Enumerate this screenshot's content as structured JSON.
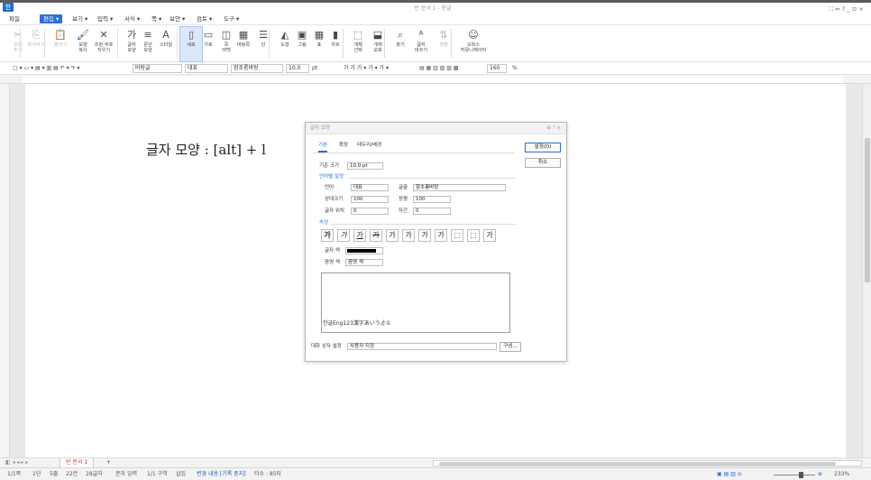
{
  "app": {
    "title": "빈 문서 1 - 한글",
    "icon": "hwp-app-icon"
  },
  "menubar": {
    "file": "파일",
    "items": [
      "편집 ▾",
      "보기 ▾",
      "입력 ▾",
      "서식 ▾",
      "쪽 ▾",
      "보안 ▾",
      "검토 ▾",
      "도구 ▾"
    ],
    "window_controls": "⛶ ⇔ ? _ ㅁ ×"
  },
  "ribbon": {
    "buttons": [
      {
        "label": "오려\n두기",
        "icon": "scissors-icon",
        "glyph": "✂",
        "disabled": true
      },
      {
        "label": "복사하기",
        "icon": "copy-icon",
        "glyph": "⎘",
        "disabled": true
      },
      {
        "label": "붙이기",
        "icon": "paste-icon",
        "glyph": "📋",
        "disabled": true
      },
      {
        "label": "모양\n복사",
        "icon": "format-painter-icon",
        "glyph": "🖌",
        "disabled": false
      },
      {
        "label": "조판 부호\n지우기",
        "icon": "clear-format-icon",
        "glyph": "✕",
        "disabled": false
      },
      {
        "label": "글자\n모양",
        "icon": "char-shape-icon",
        "glyph": "가",
        "disabled": false
      },
      {
        "label": "문단\n모양",
        "icon": "para-shape-icon",
        "glyph": "≡",
        "disabled": false
      },
      {
        "label": "스타일",
        "icon": "style-icon",
        "glyph": "A",
        "disabled": false
      },
      {
        "label": "세로",
        "icon": "portrait-icon",
        "glyph": "▯",
        "disabled": false,
        "selected": true
      },
      {
        "label": "가로",
        "icon": "landscape-icon",
        "glyph": "▭",
        "disabled": false
      },
      {
        "label": "쪽\n여백",
        "icon": "page-margin-icon",
        "glyph": "◫",
        "disabled": false
      },
      {
        "label": "바탕쪽",
        "icon": "master-page-icon",
        "glyph": "▦",
        "disabled": false
      },
      {
        "label": "단",
        "icon": "columns-icon",
        "glyph": "☰",
        "disabled": false
      },
      {
        "label": "도형",
        "icon": "shape-icon",
        "glyph": "◭",
        "disabled": false
      },
      {
        "label": "그림",
        "icon": "picture-icon",
        "glyph": "▣",
        "disabled": false
      },
      {
        "label": "표",
        "icon": "table-icon",
        "glyph": "▦",
        "disabled": false
      },
      {
        "label": "차트",
        "icon": "chart-icon",
        "glyph": "▮",
        "disabled": false
      },
      {
        "label": "개체\n선택",
        "icon": "object-select-icon",
        "glyph": "⬚",
        "disabled": false
      },
      {
        "label": "개체\n보호",
        "icon": "object-protect-icon",
        "glyph": "⬓",
        "disabled": false
      },
      {
        "label": "찾기",
        "icon": "find-icon",
        "glyph": "⌕",
        "disabled": false
      },
      {
        "label": "글자\n바꾸기",
        "icon": "replace-icon",
        "glyph": "ᴬ",
        "disabled": false
      },
      {
        "label": "정렬",
        "icon": "sort-icon",
        "glyph": "⇅",
        "disabled": true
      },
      {
        "label": "오피스\n커뮤니케이터",
        "icon": "office-communicator-icon",
        "glyph": "☺",
        "disabled": false
      }
    ]
  },
  "toolbar": {
    "style_box": "바탕글",
    "lang_box": "대표",
    "font_box": "함초롬바탕",
    "size_box": "10.0",
    "size_unit": "pt",
    "bold_italic_underline": "가 가 가 ▾ 가 ▾ 가 ▾",
    "zoom_box": "160",
    "zoom_unit": "%"
  },
  "document": {
    "text": "글자 모양 : [alt] + l"
  },
  "dialog": {
    "title": "글자 모양",
    "title_controls": "⊞ ? ×",
    "tabs": [
      "기본",
      "확장",
      "테두리/배경"
    ],
    "ok": "설정(D)",
    "cancel": "취소",
    "base_size_label": "기준 크기",
    "base_size_value": "10.0",
    "base_size_unit": "pt",
    "lang_section": "언어별 설정",
    "lang_label": "언어",
    "lang_value": "대표",
    "font_label": "글꼴",
    "font_value": "함초롬바탕",
    "ratio_label": "상대크기",
    "ratio_value": "100",
    "width_label": "장평",
    "width_value": "100",
    "pos_label": "글자 위치",
    "pos_value": "0",
    "spacing_label": "자간",
    "spacing_value": "0",
    "percent": "%",
    "attr_section": "속성",
    "attr_glyphs": [
      "가",
      "가",
      "가",
      "가",
      "가",
      "가",
      "가",
      "가",
      "⬚",
      "⬚",
      "가"
    ],
    "attr_icons": [
      "bold-icon",
      "italic-icon",
      "underline-icon",
      "strikethrough-icon",
      "outline-icon",
      "shadow-icon",
      "emboss-icon",
      "engrave-icon",
      "superscript-icon",
      "subscript-icon",
      "normal-icon"
    ],
    "text_color_label": "글자 색",
    "shade_color_label": "음영 색",
    "shade_color_value": "음영 색",
    "preview_text": "한글Eng123漢字あいうゟ①",
    "preset_label": "대화 상자 설정",
    "preset_value": "사용자 지정",
    "config_button": "구성..."
  },
  "tabbar": {
    "sheet": "빈 문서 1",
    "add": "+"
  },
  "status": {
    "items": [
      "1/1쪽",
      "1단",
      "5줄",
      "22칸",
      "28글자",
      "문자 입력",
      "1/1 구역",
      "삽입",
      "변경 내용 [기록 중지]",
      "타수 : 85타"
    ],
    "zoom": "233%"
  },
  "colors": {
    "accent": "#2a6fd6",
    "text_color": "#000000",
    "sheet_tab": "#d33333"
  }
}
